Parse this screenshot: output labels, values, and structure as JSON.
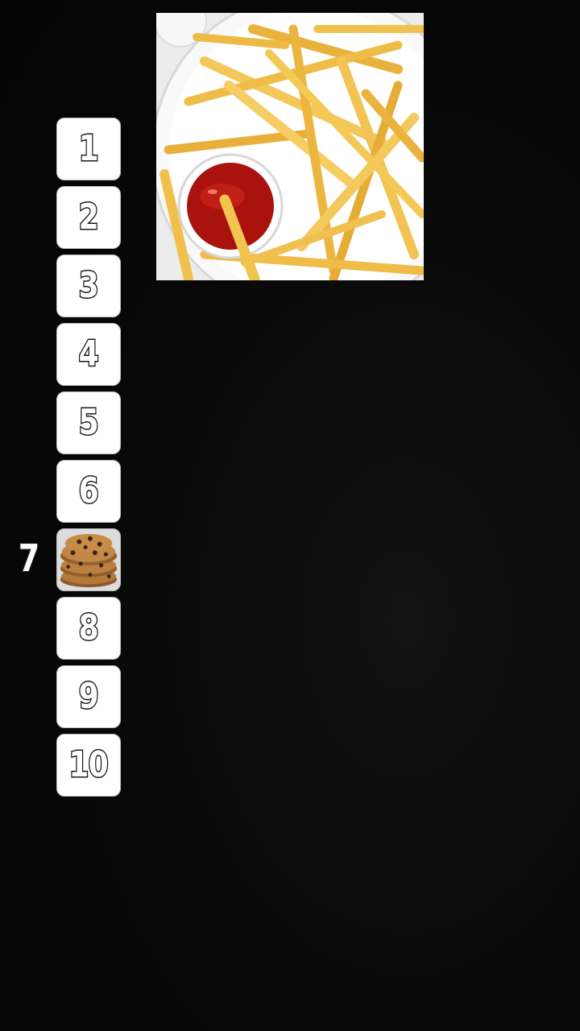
{
  "feature_image": {
    "subject": "french fries with ketchup",
    "icon": "fries-photo"
  },
  "ranking": {
    "current_label": "7",
    "slots": [
      {
        "label": "1",
        "filled": false
      },
      {
        "label": "2",
        "filled": false
      },
      {
        "label": "3",
        "filled": false
      },
      {
        "label": "4",
        "filled": false
      },
      {
        "label": "5",
        "filled": false
      },
      {
        "label": "6",
        "filled": false
      },
      {
        "label": "7",
        "filled": true,
        "icon": "cookies-photo"
      },
      {
        "label": "8",
        "filled": false
      },
      {
        "label": "9",
        "filled": false
      },
      {
        "label": "10",
        "filled": false
      }
    ]
  },
  "colors": {
    "background": "#070707",
    "slot": "#ffffff",
    "ketchup": "#b3140f",
    "fries": "#f2c24a"
  }
}
